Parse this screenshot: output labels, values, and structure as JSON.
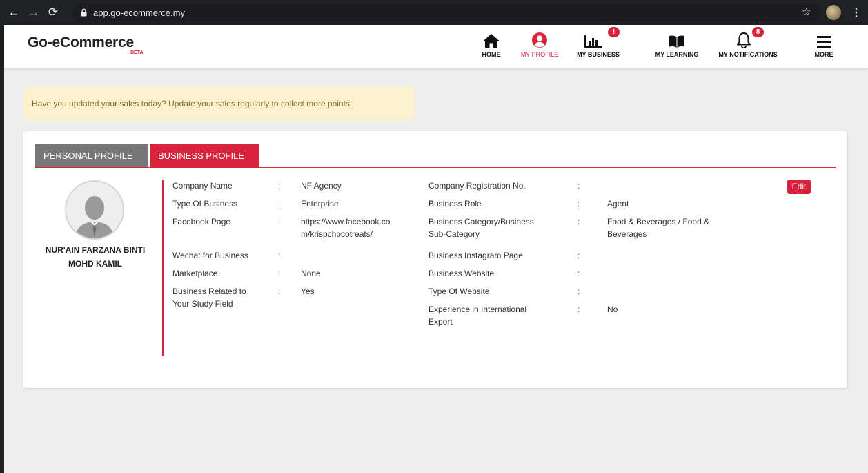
{
  "browser": {
    "url": "app.go-ecommerce.my",
    "back_icon": "←",
    "forward_icon": "→",
    "reload_icon": "⟳",
    "star_icon": "☆",
    "menu_icon": "⋮"
  },
  "header": {
    "logo": "Go-eCommerce",
    "beta": "BETA",
    "nav": {
      "home": {
        "label": "HOME",
        "icon": "home-icon"
      },
      "profile": {
        "label": "MY PROFILE",
        "icon": "user-circle-icon"
      },
      "business": {
        "label": "MY BUSINESS",
        "icon": "bar-chart-icon",
        "badge": "!"
      },
      "learning": {
        "label": "MY LEARNING",
        "icon": "book-icon"
      },
      "notifications": {
        "label": "MY NOTIFICATIONS",
        "icon": "bell-icon",
        "badge": "8"
      },
      "more": {
        "label": "MORE",
        "icon": "hamburger-icon"
      }
    }
  },
  "alert": {
    "text": "Have you updated your sales today? Update your sales regularly to collect more points!"
  },
  "tabs": {
    "personal": "PERSONAL PROFILE",
    "business": "BUSINESS PROFILE"
  },
  "user": {
    "name_line1": "NUR'AIN FARZANA BINTI",
    "name_line2": "MOHD KAMIL"
  },
  "edit_label": "Edit",
  "colon": ":",
  "left_fields": {
    "company_name": {
      "label": "Company Name",
      "value": "NF Agency"
    },
    "type_of_business": {
      "label": "Type Of Business",
      "value": "Enterprise"
    },
    "facebook_page": {
      "label": "Facebook Page",
      "value_line1": "https://www.facebook.co",
      "value_line2": "m/krispchocotreats/"
    },
    "wechat": {
      "label": "Wechat for Business",
      "value": ""
    },
    "marketplace": {
      "label": "Marketplace",
      "value": "None"
    },
    "related_study": {
      "label_line1": "Business Related to",
      "label_line2": "Your Study Field",
      "value": "Yes"
    }
  },
  "right_fields": {
    "registration_no": {
      "label": "Company Registration No.",
      "value": ""
    },
    "business_role": {
      "label": "Business Role",
      "value": "Agent"
    },
    "category": {
      "label_line1": "Business Category/Business",
      "label_line2": "Sub-Category",
      "value_line1": "Food & Beverages / Food &",
      "value_line2": "Beverages"
    },
    "instagram": {
      "label": "Business Instagram Page",
      "value": ""
    },
    "website": {
      "label": "Business Website",
      "value": ""
    },
    "type_of_website": {
      "label": "Type Of Website",
      "value": ""
    },
    "export": {
      "label_line1": "Experience in International",
      "label_line2": "Export",
      "value": "No"
    }
  },
  "colors": {
    "accent": "#d9233d",
    "tab_inactive": "#777777",
    "alert_bg": "#fcf1cf",
    "alert_text": "#816a2b",
    "page_bg": "#eeeeee"
  }
}
